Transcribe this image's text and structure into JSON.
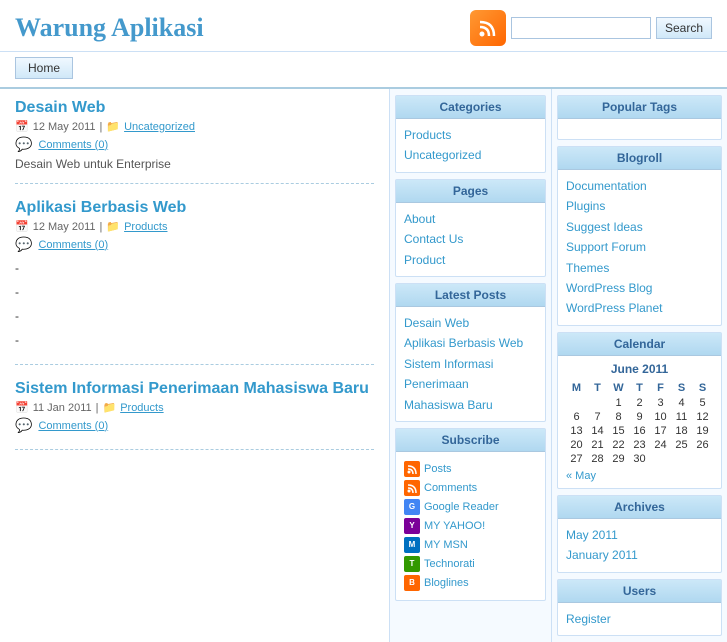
{
  "site": {
    "title": "Warung Aplikasi"
  },
  "header": {
    "search_placeholder": "",
    "search_button_label": "Search",
    "rss_icon": "rss"
  },
  "nav": {
    "home_label": "Home"
  },
  "posts": [
    {
      "id": "post-1",
      "title": "Desain Web",
      "date": "12 May 2011",
      "category": "Uncategorized",
      "category_link": "Uncategorized",
      "comments": "Comments (0)",
      "excerpt": "Desain Web untuk Enterprise",
      "bullets": []
    },
    {
      "id": "post-2",
      "title": "Aplikasi Berbasis Web",
      "date": "12 May 2011",
      "category": "Products",
      "category_link": "Products",
      "comments": "Comments (0)",
      "excerpt": "",
      "bullets": [
        "-",
        "-",
        "-",
        "-"
      ]
    },
    {
      "id": "post-3",
      "title": "Sistem Informasi Penerimaan Mahasiswa Baru",
      "date": "11 Jan 2011",
      "category": "Products",
      "category_link": "Products",
      "comments": "Comments (0)",
      "excerpt": "",
      "bullets": []
    }
  ],
  "sidebar_mid": {
    "categories": {
      "title": "Categories",
      "items": [
        "Products",
        "Uncategorized"
      ]
    },
    "pages": {
      "title": "Pages",
      "items": [
        "About",
        "Contact Us",
        "Product"
      ]
    },
    "latest_posts": {
      "title": "Latest Posts",
      "items": [
        "Desain Web",
        "Aplikasi Berbasis Web",
        "Sistem Informasi Penerimaan",
        "Mahasiswa Baru"
      ]
    },
    "subscribe": {
      "title": "Subscribe",
      "items": [
        {
          "label": "Posts",
          "icon": "rss"
        },
        {
          "label": "Comments",
          "icon": "rss"
        },
        {
          "label": "Google Reader",
          "icon": "google"
        },
        {
          "label": "MY YAHOO!",
          "icon": "yahoo"
        },
        {
          "label": "MY MSN",
          "icon": "msn"
        },
        {
          "label": "Technorati",
          "icon": "technorati"
        },
        {
          "label": "Bloglines",
          "icon": "bloglines"
        }
      ]
    }
  },
  "sidebar_right": {
    "popular_tags": {
      "title": "Popular Tags"
    },
    "blogroll": {
      "title": "Blogroll",
      "items": [
        "Documentation",
        "Plugins",
        "Suggest Ideas",
        "Support Forum",
        "Themes",
        "WordPress Blog",
        "WordPress Planet"
      ]
    },
    "calendar": {
      "title": "Calendar",
      "month_year": "June 2011",
      "headers": [
        "M",
        "T",
        "W",
        "T",
        "F",
        "S",
        "S"
      ],
      "weeks": [
        [
          "",
          "",
          "1",
          "2",
          "3",
          "4",
          "5"
        ],
        [
          "6",
          "7",
          "8",
          "9",
          "10",
          "11",
          "12"
        ],
        [
          "13",
          "14",
          "15",
          "16",
          "17",
          "18",
          "19"
        ],
        [
          "20",
          "21",
          "22",
          "23",
          "24",
          "25",
          "26"
        ],
        [
          "27",
          "28",
          "29",
          "30",
          "",
          "",
          ""
        ]
      ],
      "prev_label": "« May",
      "next_label": ""
    },
    "archives": {
      "title": "Archives",
      "items": [
        "May 2011",
        "January 2011"
      ]
    },
    "users": {
      "title": "Users",
      "items": [
        "Register"
      ]
    }
  }
}
